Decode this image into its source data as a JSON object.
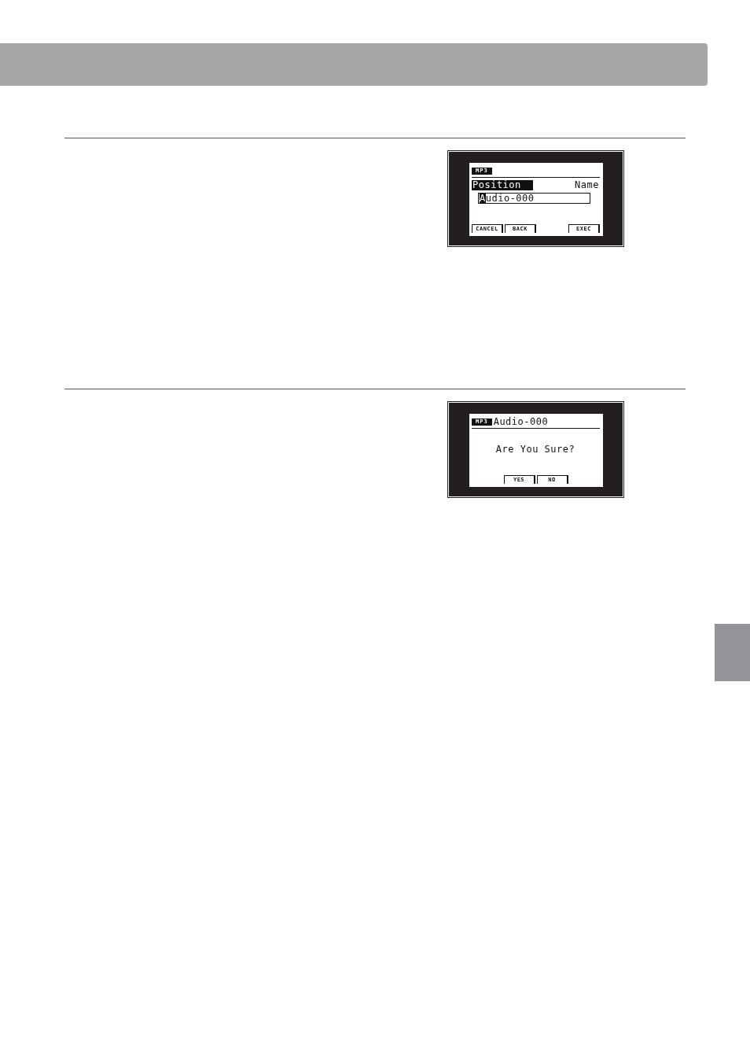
{
  "screens": [
    {
      "kind": "edit",
      "badge": "MP3",
      "tabs": [
        {
          "label": "Position",
          "selected": true
        },
        {
          "label": "Name",
          "selected": false
        }
      ],
      "field": {
        "cursor_char": "A",
        "after_cursor": "udio-000"
      },
      "softkeys_left": [
        {
          "label": "CANCEL"
        },
        {
          "label": "BACK"
        }
      ],
      "softkeys_right": [
        {
          "label": "EXEC"
        }
      ]
    },
    {
      "kind": "confirm",
      "badge": "MP3",
      "title": "Audio-000",
      "message": "Are You Sure?",
      "softkeys": [
        {
          "label": "YES"
        },
        {
          "label": "NO"
        }
      ]
    }
  ]
}
